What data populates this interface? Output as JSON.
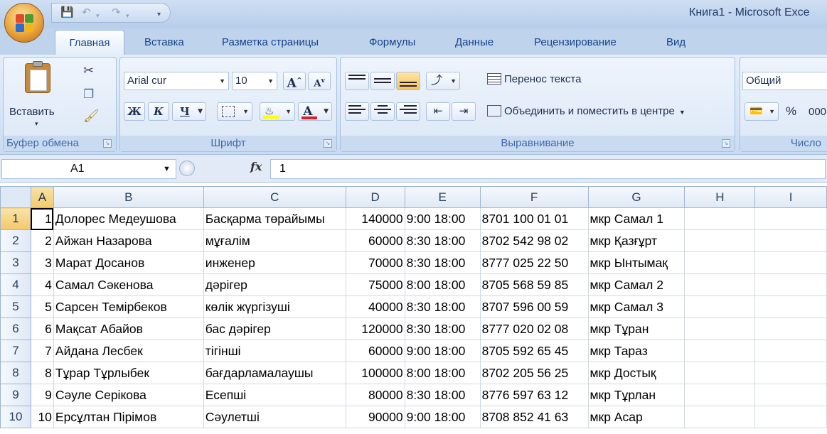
{
  "window": {
    "title": "Книга1 - Microsoft Exce"
  },
  "tabs": [
    "Главная",
    "Вставка",
    "Разметка страницы",
    "Формулы",
    "Данные",
    "Рецензирование",
    "Вид"
  ],
  "ribbon": {
    "clipboard": {
      "paste_label": "Вставить",
      "group_label": "Буфер обмена"
    },
    "font": {
      "font_name": "Arial cur",
      "font_size": "10",
      "bold": "Ж",
      "italic": "К",
      "underline": "Ч",
      "font_color_letter": "А",
      "grow": "А",
      "shrink": "А",
      "group_label": "Шрифт"
    },
    "alignment": {
      "wrap_text": "Перенос текста",
      "merge_center": "Объединить и поместить в центре",
      "group_label": "Выравнивание"
    },
    "number": {
      "format": "Общий",
      "percent": "%",
      "thousands": "000",
      "group_label": "Число"
    }
  },
  "formula_bar": {
    "name_box": "A1",
    "fx": "fx",
    "content": "1"
  },
  "grid": {
    "columns": [
      "A",
      "B",
      "C",
      "D",
      "E",
      "F",
      "G",
      "H",
      "I"
    ],
    "rows": [
      {
        "num": "1",
        "a": "1",
        "b": "Долорес Медеушова",
        "c": "Басқарма төрайымы",
        "d": "140000",
        "e": "9:00 18:00",
        "f": "8701 100 01 01",
        "g": "мкр Самал 1"
      },
      {
        "num": "2",
        "a": "2",
        "b": " Айжан Назарова",
        "c": "мұғалім",
        "d": "60000",
        "e": "8:30 18:00",
        "f": "8702 542 98 02",
        "g": "мкр Қазғұрт"
      },
      {
        "num": "3",
        "a": "3",
        "b": "Марат Досанов",
        "c": "инженер",
        "d": "70000",
        "e": "8:30 18:00",
        "f": "8777 025 22 50",
        "g": "мкр Ынтымақ"
      },
      {
        "num": "4",
        "a": "4",
        "b": "Самал Сәкенова",
        "c": "дәрігер",
        "d": "75000",
        "e": "8:00 18:00",
        "f": "8705 568 59 85",
        "g": "мкр Самал 2"
      },
      {
        "num": "5",
        "a": "5",
        "b": "Сарсен Темірбеков",
        "c": "көлік жүргізуші",
        "d": "40000",
        "e": "8:30 18:00",
        "f": "8707 596 00 59",
        "g": "мкр Самал 3"
      },
      {
        "num": "6",
        "a": "6",
        "b": "Мақсат Абайов",
        "c": "бас дәрігер",
        "d": "120000",
        "e": "8:30 18:00",
        "f": "8777 020 02 08",
        "g": "мкр Тұран"
      },
      {
        "num": "7",
        "a": "7",
        "b": "Айдана Лесбек",
        "c": "тігінші",
        "d": "60000",
        "e": "9:00 18:00",
        "f": "8705 592 65 45",
        "g": "мкр Тараз"
      },
      {
        "num": "8",
        "a": "8",
        "b": "Тұрар Тұрлыбек",
        "c": "бағдарламалаушы",
        "d": "100000",
        "e": "8:00 18:00",
        "f": "8702 205 56 25",
        "g": "мкр Достық"
      },
      {
        "num": "9",
        "a": "9",
        "b": "Сәуле Серікова",
        "c": "Есепші",
        "d": "80000",
        "e": "8:30 18:00",
        "f": "8776 597 63 12",
        "g": "мкр Тұрлан"
      },
      {
        "num": "10",
        "a": "10",
        "b": "Ерсұлтан Пірімов",
        "c": "Сәулетші",
        "d": "90000",
        "e": "9:00 18:00",
        "f": "8708 852 41 63",
        "g": "мкр Асар"
      }
    ]
  }
}
